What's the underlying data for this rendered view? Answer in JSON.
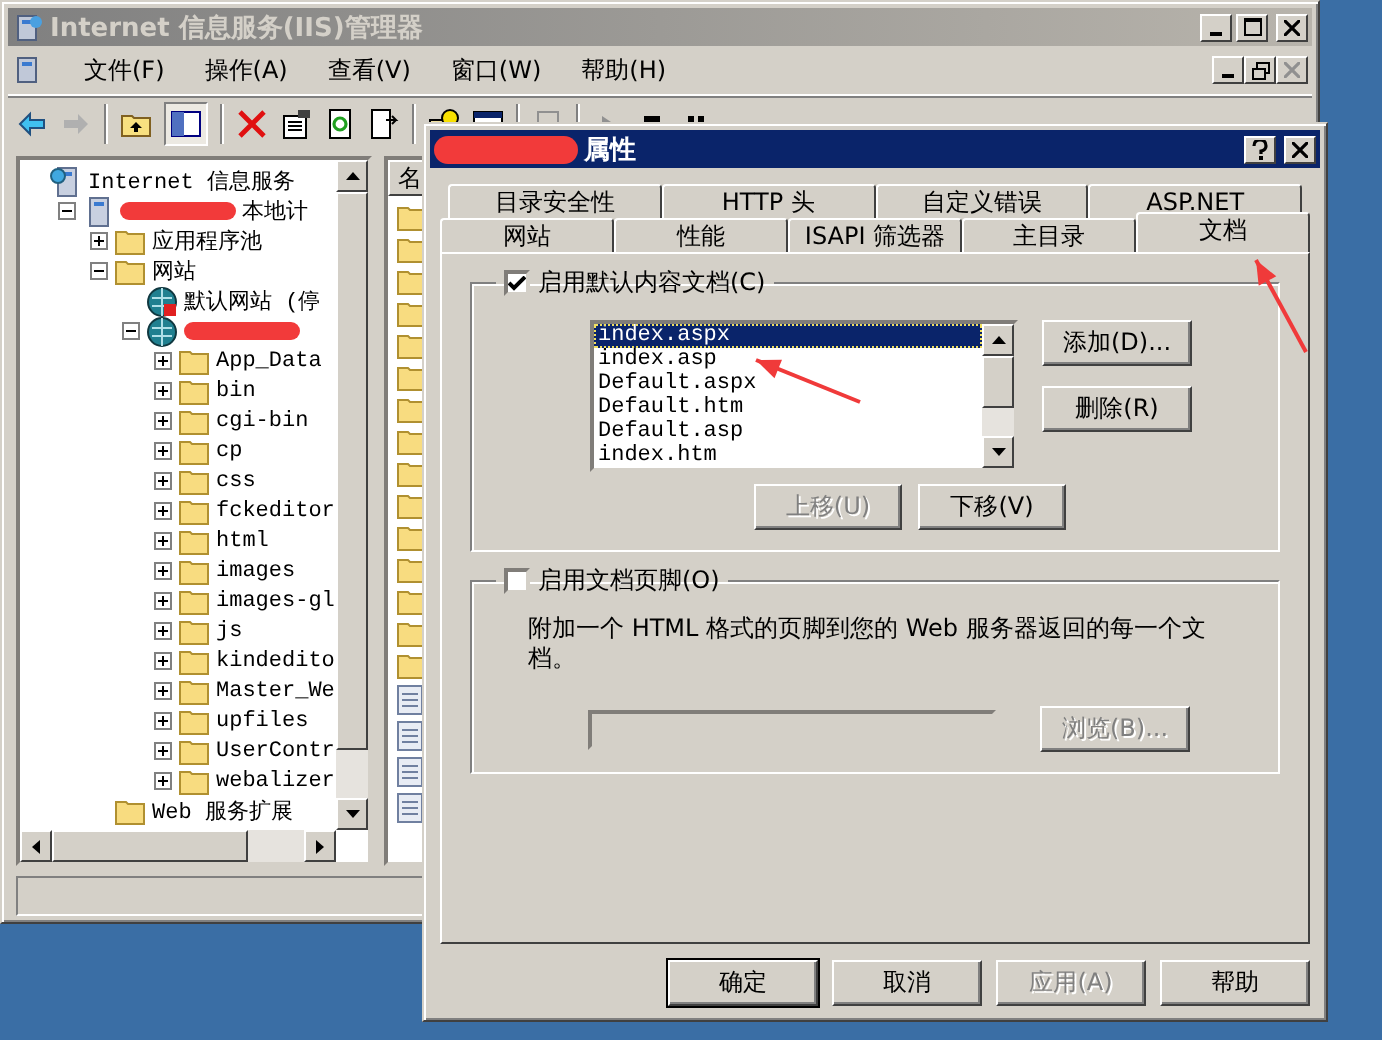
{
  "main_window": {
    "title": "Internet 信息服务(IIS)管理器",
    "active": false
  },
  "menu": [
    "文件(F)",
    "操作(A)",
    "查看(V)",
    "窗口(W)",
    "帮助(H)"
  ],
  "tree": [
    {
      "label": "Internet 信息服务",
      "kind": "iis",
      "children": [
        {
          "label": "本地计",
          "redacted": true,
          "kind": "computer",
          "expanded": true,
          "children": [
            {
              "label": "应用程序池",
              "kind": "folder",
              "expanded": false
            },
            {
              "label": "网站",
              "kind": "folder",
              "expanded": true,
              "children": [
                {
                  "label": "默认网站 (停",
                  "kind": "site-stopped"
                },
                {
                  "redacted": true,
                  "kind": "site",
                  "expanded": true,
                  "children": [
                    {
                      "label": "App_Data",
                      "kind": "folder",
                      "expanded": false
                    },
                    {
                      "label": "bin",
                      "kind": "folder",
                      "expanded": false
                    },
                    {
                      "label": "cgi-bin",
                      "kind": "folder",
                      "expanded": false
                    },
                    {
                      "label": "cp",
                      "kind": "folder",
                      "expanded": false
                    },
                    {
                      "label": "css",
                      "kind": "folder",
                      "expanded": false
                    },
                    {
                      "label": "fckeditor",
                      "kind": "folder",
                      "expanded": false
                    },
                    {
                      "label": "html",
                      "kind": "folder",
                      "expanded": false
                    },
                    {
                      "label": "images",
                      "kind": "folder",
                      "expanded": false
                    },
                    {
                      "label": "images-gl",
                      "kind": "folder",
                      "expanded": false
                    },
                    {
                      "label": "js",
                      "kind": "folder",
                      "expanded": false
                    },
                    {
                      "label": "kindedito",
                      "kind": "folder",
                      "expanded": false
                    },
                    {
                      "label": "Master_We",
                      "kind": "folder",
                      "expanded": false
                    },
                    {
                      "label": "upfiles",
                      "kind": "folder",
                      "expanded": false
                    },
                    {
                      "label": "UserContr",
                      "kind": "folder",
                      "expanded": false
                    },
                    {
                      "label": "webalizer",
                      "kind": "folder",
                      "expanded": false
                    }
                  ]
                }
              ]
            },
            {
              "label": "Web 服务扩展",
              "kind": "folder"
            }
          ]
        }
      ]
    }
  ],
  "right_pane": {
    "column_1": "名",
    "items": [
      {
        "kind": "folder"
      },
      {
        "kind": "folder"
      },
      {
        "kind": "folder"
      },
      {
        "kind": "folder"
      },
      {
        "kind": "folder"
      },
      {
        "kind": "folder"
      },
      {
        "kind": "folder"
      },
      {
        "kind": "folder"
      },
      {
        "kind": "folder"
      },
      {
        "kind": "folder"
      },
      {
        "kind": "folder"
      },
      {
        "kind": "folder"
      },
      {
        "kind": "folder"
      },
      {
        "kind": "folder"
      },
      {
        "kind": "folder"
      },
      {
        "kind": "file"
      },
      {
        "kind": "file"
      },
      {
        "kind": "file"
      },
      {
        "kind": "file"
      }
    ]
  },
  "dialog": {
    "title": "属性",
    "title_redacted": true,
    "tabs_back": [
      {
        "label": "目录安全性",
        "selected": false
      },
      {
        "label": "HTTP 头",
        "selected": false
      },
      {
        "label": "自定义错误",
        "selected": false
      },
      {
        "label": "ASP.NET",
        "selected": false
      }
    ],
    "tabs_front": [
      {
        "label": "网站",
        "selected": false
      },
      {
        "label": "性能",
        "selected": false
      },
      {
        "label": "ISAPI 筛选器",
        "selected": false
      },
      {
        "label": "主目录",
        "selected": false
      },
      {
        "label": "文档",
        "selected": true
      }
    ],
    "default_doc": {
      "label": "启用默认内容文档(C)",
      "checked": true,
      "documents": [
        {
          "name": "index.aspx",
          "selected": true
        },
        {
          "name": "index.asp",
          "selected": false
        },
        {
          "name": "Default.aspx",
          "selected": false
        },
        {
          "name": "Default.htm",
          "selected": false
        },
        {
          "name": "Default.asp",
          "selected": false
        },
        {
          "name": "index.htm",
          "selected": false
        }
      ],
      "side_buttons": [
        {
          "label": "添加(D)...",
          "disabled": false
        },
        {
          "label": "删除(R)",
          "disabled": false
        }
      ],
      "move_buttons": [
        {
          "label": "上移(U)",
          "disabled": true
        },
        {
          "label": "下移(V)",
          "disabled": false
        }
      ]
    },
    "footer": {
      "label": "启用文档页脚(O)",
      "checked": false,
      "description": "附加一个 HTML 格式的页脚到您的 Web 服务器返回的每一个文档。",
      "browse_button": {
        "label": "浏览(B)...",
        "disabled": true
      }
    },
    "buttons": [
      {
        "label": "确定",
        "default": true,
        "disabled": false
      },
      {
        "label": "取消",
        "default": false,
        "disabled": false
      },
      {
        "label": "应用(A)",
        "default": false,
        "disabled": true
      },
      {
        "label": "帮助",
        "default": false,
        "disabled": false
      }
    ]
  },
  "annotation_arrows": [
    {
      "kind": "arrow"
    },
    {
      "kind": "arrow"
    }
  ]
}
